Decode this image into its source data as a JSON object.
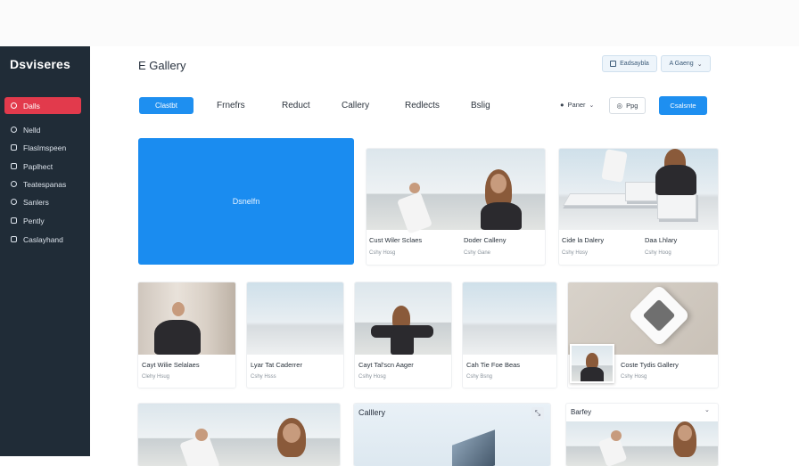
{
  "sidebar": {
    "brand": "Dsviseres",
    "items": [
      {
        "label": "Dalls",
        "active": true
      },
      {
        "label": "Nelld"
      },
      {
        "label": "Flaslmspeen"
      },
      {
        "label": "Paplhect"
      },
      {
        "label": "Teatespanas"
      },
      {
        "label": "Sanlers"
      },
      {
        "label": "Pently"
      },
      {
        "label": "Caslayhand"
      }
    ]
  },
  "header": {
    "title": "E Gallery",
    "btn_dashboard": "Eadsaybla",
    "btn_gallery": "A Gaeng"
  },
  "tabs": {
    "primary": "Clastbt",
    "items": [
      "Frnefrs",
      "Reduct",
      "Callery",
      "Redlects",
      "Bslig"
    ],
    "filter": "Paner",
    "pill": "Ppg",
    "cta": "Csalsnte"
  },
  "hero": {
    "label": "Dsnelfn"
  },
  "row1": [
    {
      "title": "Cust Wiler Sclaes",
      "sub": "Cshy Hosg"
    },
    {
      "title": "Doder Calleny",
      "sub": "Cshy Gane"
    },
    {
      "title": "Cide la Dalery",
      "sub": "Cshy Hosy"
    },
    {
      "title": "Daa Lhlary",
      "sub": "Cshy Hoog"
    }
  ],
  "row2": [
    {
      "title": "Cayt Wilie Selalaes",
      "sub": "Clehy Hsug"
    },
    {
      "title": "Lyar Tat Caderrer",
      "sub": "Cshy Hsss"
    },
    {
      "title": "Cayt Tal'scn Aager",
      "sub": "Cslhy Hosg"
    },
    {
      "title": "Cah Tie Foe Beas",
      "sub": "Cshy Bsng"
    },
    {
      "title": "Coste Tydis Gallery",
      "sub": "Cshy Hosg"
    }
  ],
  "row3": {
    "gallery_title": "Calllery",
    "panel_title": "Barfey"
  },
  "colors": {
    "sidebar_bg": "#202c37",
    "accent_red": "#e23a4c",
    "accent_blue": "#1e8ff0"
  },
  "icons": [
    "home-icon",
    "grid-icon",
    "user-icon",
    "chevron-down-icon",
    "pin-icon",
    "expand-icon"
  ]
}
